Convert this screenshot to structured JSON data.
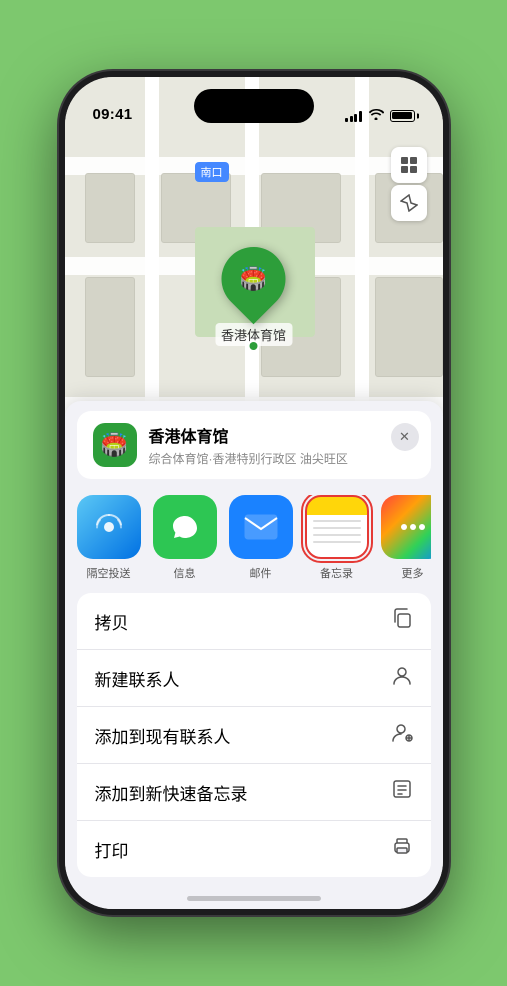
{
  "status_bar": {
    "time": "09:41",
    "navigation_arrow": "▶"
  },
  "map": {
    "label": "南口",
    "location_name": "香港体育馆",
    "map_icon": "🏟️"
  },
  "location_card": {
    "title": "香港体育馆",
    "address": "综合体育馆·香港特别行政区 油尖旺区",
    "close_label": "✕"
  },
  "apps": [
    {
      "id": "airdrop",
      "label": "隔空投送",
      "icon_type": "airdrop"
    },
    {
      "id": "messages",
      "label": "信息",
      "icon_type": "messages"
    },
    {
      "id": "mail",
      "label": "邮件",
      "icon_type": "mail"
    },
    {
      "id": "notes",
      "label": "备忘录",
      "icon_type": "notes",
      "selected": true
    },
    {
      "id": "more",
      "label": "更多",
      "icon_type": "more"
    }
  ],
  "actions": [
    {
      "id": "copy",
      "label": "拷贝",
      "icon": "⎘"
    },
    {
      "id": "new-contact",
      "label": "新建联系人",
      "icon": "👤"
    },
    {
      "id": "add-contact",
      "label": "添加到现有联系人",
      "icon": "👤"
    },
    {
      "id": "quick-note",
      "label": "添加到新快速备忘录",
      "icon": "📋"
    },
    {
      "id": "print",
      "label": "打印",
      "icon": "🖨"
    }
  ],
  "home_indicator": true
}
